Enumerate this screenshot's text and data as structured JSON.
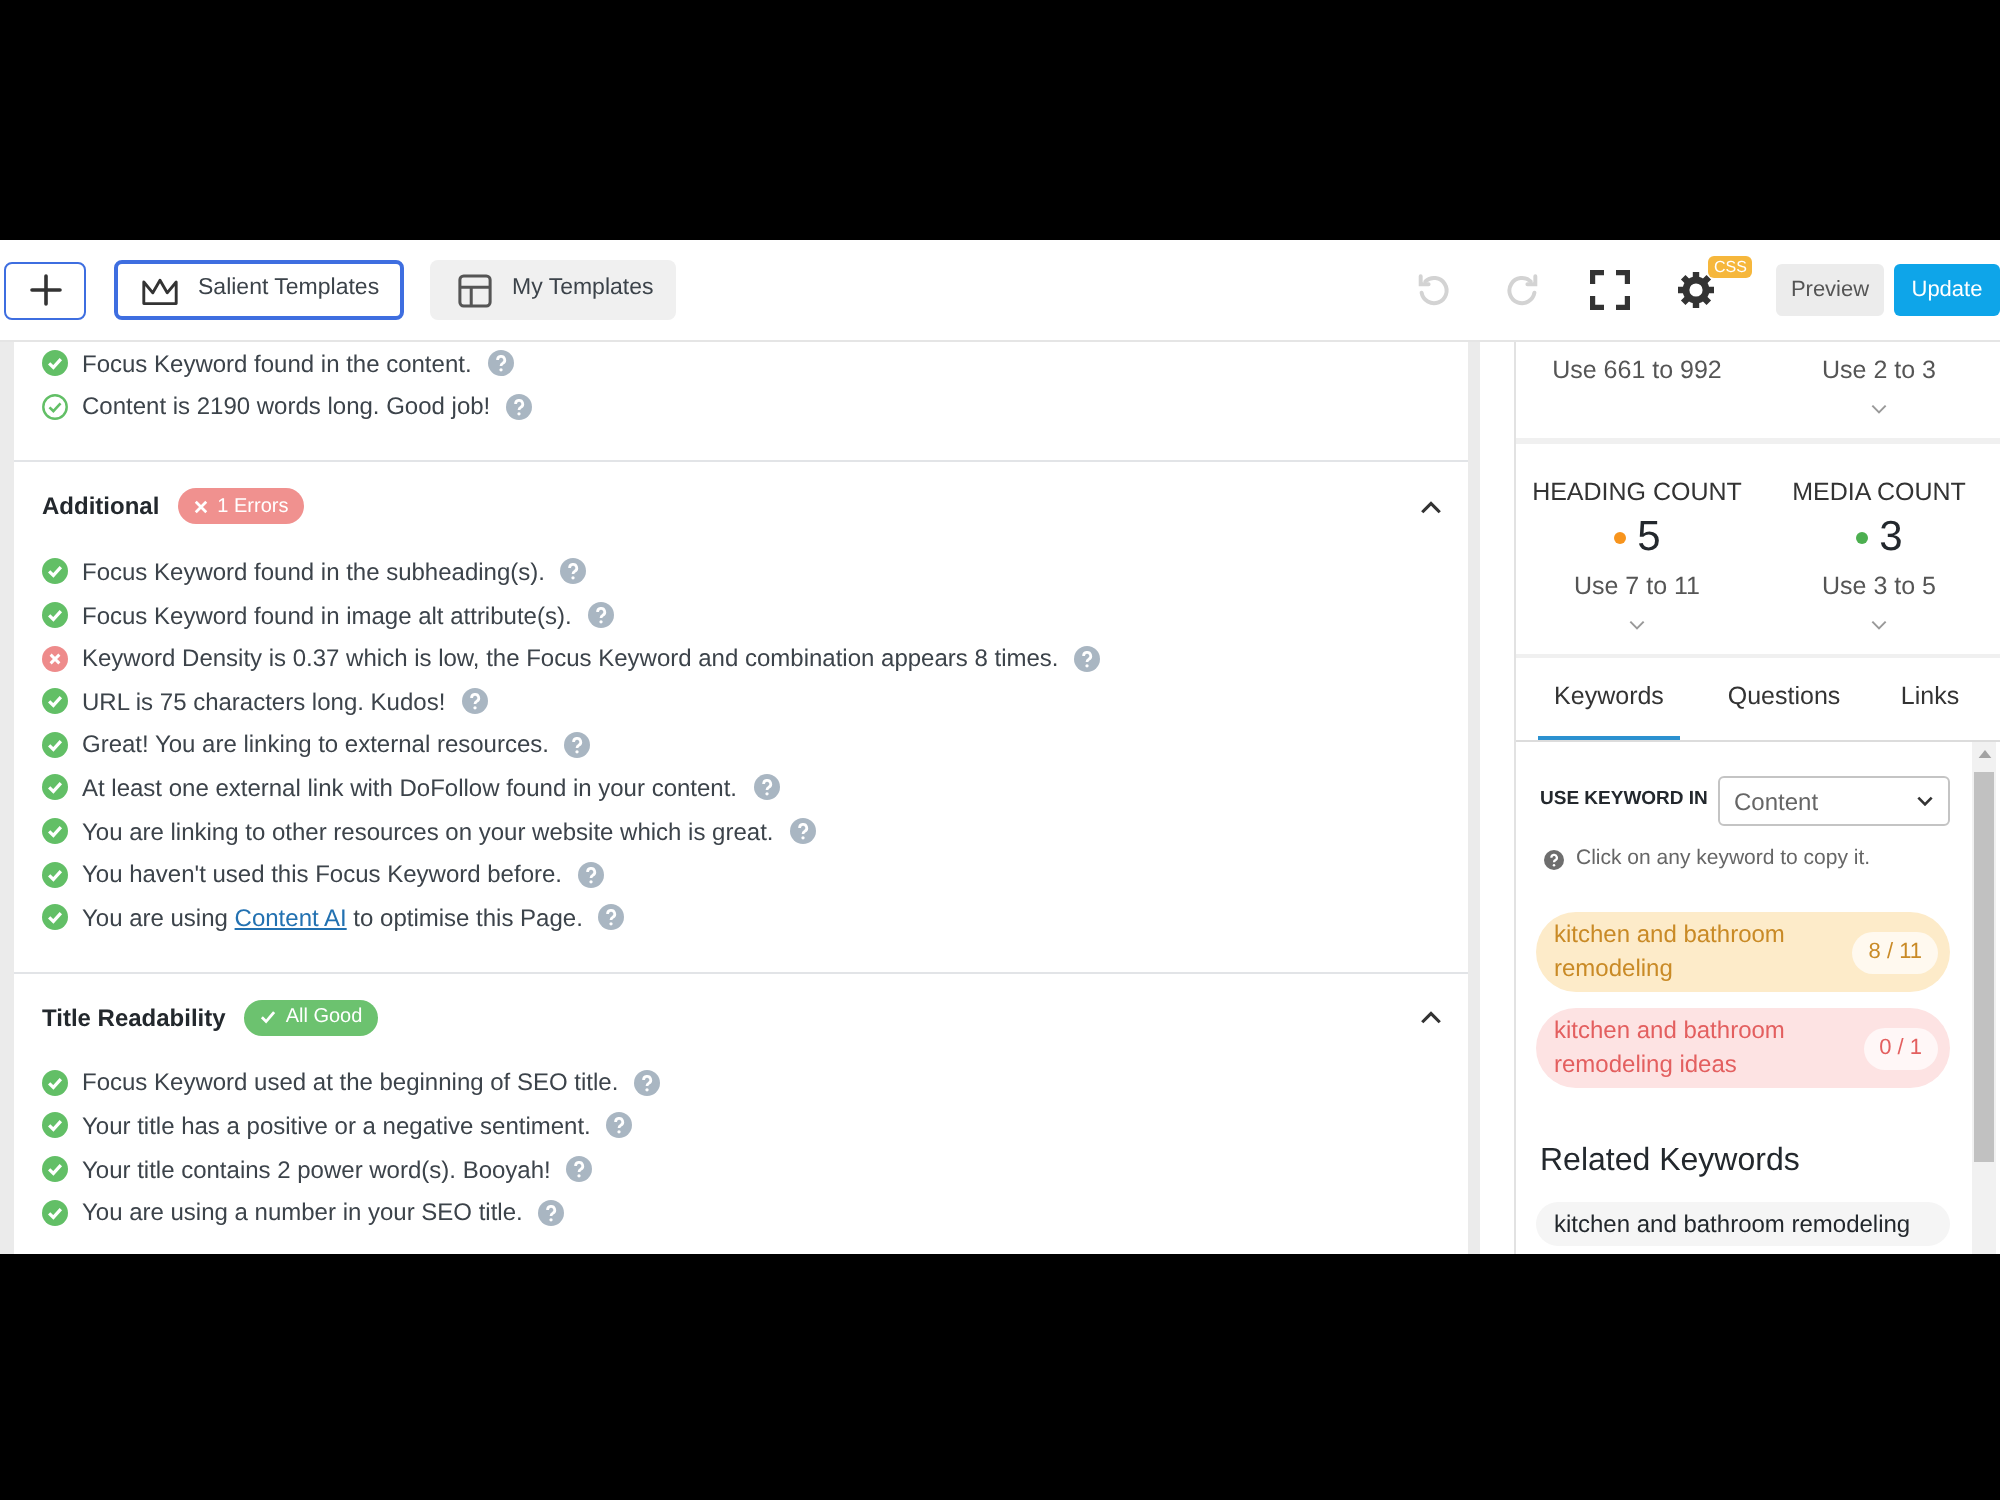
{
  "toolbar": {
    "templates": [
      {
        "label": "Salient Templates",
        "kind": "outlined"
      },
      {
        "label": "My Templates",
        "kind": "filled"
      }
    ],
    "undo": {
      "disabled": true
    },
    "redo": {
      "disabled": true
    },
    "settings_badge": "CSS",
    "actions": [
      {
        "label": "Preview",
        "kind": "secondary"
      },
      {
        "label": "Update",
        "kind": "primary"
      }
    ]
  },
  "analysis": {
    "sections": [
      {
        "items": [
          {
            "kind": "good",
            "text": "Focus Keyword found in the content."
          },
          {
            "kind": "outline",
            "text": "Content is 2190 words long. Good job!"
          }
        ]
      },
      {
        "title": "Additional",
        "badge": {
          "kind": "error",
          "label": "1 Errors"
        },
        "expanded": true,
        "items": [
          {
            "kind": "good",
            "text": "Focus Keyword found in the subheading(s)."
          },
          {
            "kind": "good",
            "text": "Focus Keyword found in image alt attribute(s)."
          },
          {
            "kind": "error",
            "text": "Keyword Density is 0.37 which is low, the Focus Keyword and combination appears 8 times."
          },
          {
            "kind": "good",
            "text": "URL is 75 characters long. Kudos!"
          },
          {
            "kind": "good",
            "text": "Great! You are linking to external resources."
          },
          {
            "kind": "good",
            "text": "At least one external link with DoFollow found in your content."
          },
          {
            "kind": "good",
            "text": "You are linking to other resources on your website which is great."
          },
          {
            "kind": "good",
            "text": "You haven't used this Focus Keyword before."
          },
          {
            "kind": "good",
            "text": "You are using ",
            "link": "Content AI",
            "text_after": " to optimise this Page."
          }
        ]
      },
      {
        "title": "Title Readability",
        "badge": {
          "kind": "good",
          "label": "All Good"
        },
        "expanded": true,
        "items": [
          {
            "kind": "good",
            "text": "Focus Keyword used at the beginning of SEO title."
          },
          {
            "kind": "good",
            "text": "Your title has a positive or a negative sentiment."
          },
          {
            "kind": "good",
            "text": "Your title contains 2 power word(s). Booyah!"
          },
          {
            "kind": "good",
            "text": "You are using a number in your SEO title."
          }
        ]
      }
    ]
  },
  "sidebar": {
    "stats": [
      [
        {
          "hint": "Use 661 to 992"
        },
        {
          "hint": "Use 2 to 3",
          "expandable": true
        }
      ],
      [
        {
          "label": "HEADING COUNT",
          "color": "#f7941d",
          "value": "5",
          "hint": "Use 7 to 11",
          "expandable": true
        },
        {
          "label": "MEDIA COUNT",
          "color": "#4caf50",
          "value": "3",
          "hint": "Use 3 to 5",
          "expandable": true
        }
      ]
    ],
    "tabs": [
      {
        "label": "Keywords",
        "selected": true
      },
      {
        "label": "Questions",
        "selected": false
      },
      {
        "label": "Links",
        "selected": false
      }
    ],
    "keyword_filter": {
      "label": "USE KEYWORD IN",
      "value": "Content"
    },
    "help_text": "Click on any keyword to copy it.",
    "keywords": [
      {
        "text": "kitchen and bathroom remodeling",
        "count": "8 / 11",
        "kind": "partial"
      },
      {
        "text": "kitchen and bathroom remodeling ideas",
        "count": "0 / 1",
        "kind": "missing"
      }
    ],
    "related_heading": "Related Keywords",
    "related_keywords": [
      "kitchen and bathroom remodeling"
    ]
  }
}
